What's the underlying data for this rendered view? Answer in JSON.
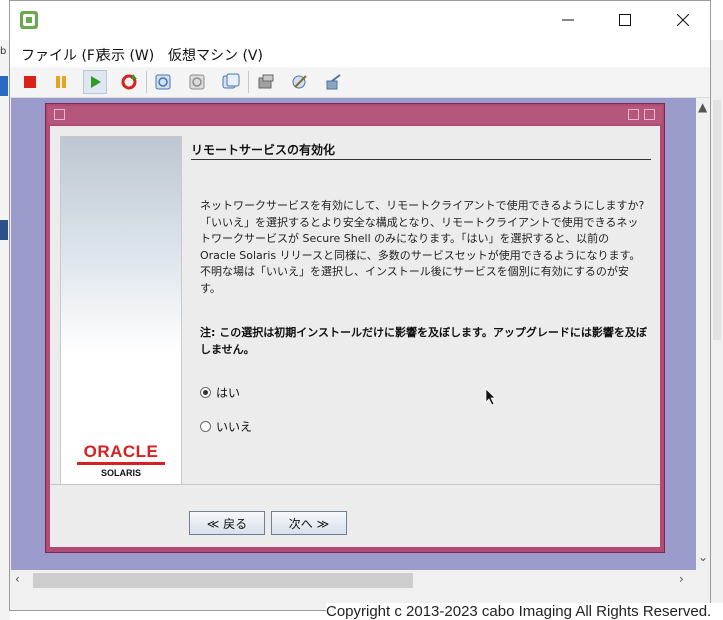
{
  "window": {
    "title": "",
    "controls": {
      "minimize": "minimize-icon",
      "maximize": "maximize-icon",
      "close": "close-icon"
    }
  },
  "menu": {
    "file": "ファイル (F)",
    "view": "表示 (W)",
    "vm": "仮想マシン (V)"
  },
  "toolbar": {
    "icons": [
      "stop-icon",
      "pause-icon",
      "play-icon",
      "reset-icon",
      "snapshot-icon",
      "revert-snapshot-icon",
      "manage-snapshots-icon",
      "settings-icon",
      "tools-icon",
      "devices-icon"
    ]
  },
  "installer": {
    "heading": "リモートサービスの有効化",
    "description": "ネットワークサービスを有効にして、リモートクライアントで使用できるようにしますか? 「いいえ」を選択するとより安全な構成となり、リモートクライアントで使用できるネットワークサービスが Secure Shell のみになります。「はい」を選択すると、以前の Oracle Solaris リリースと同様に、多数のサービスセットが使用できるようになります。不明な場は「いいえ」を選択し、インストール後にサービスを個別に有効にするのが安 す。",
    "note": "注: この選択は初期インストールだけに影響を及ぼします。アップグレードには影響を及ぼしません。",
    "options": [
      {
        "label": "はい",
        "selected": true
      },
      {
        "label": "いいえ",
        "selected": false
      }
    ],
    "back_button": "≪ 戻る",
    "next_button": "次へ ≫",
    "logo_word": "ORACLE",
    "logo_sub": "SOLARIS"
  },
  "copyright": "Copyright c 2013-2023 cabo Imaging All Rights Reserved.",
  "colors": {
    "installer_frame": "#b14a74",
    "guest_background": "#9a9acb",
    "oracle_red": "#d62021"
  }
}
